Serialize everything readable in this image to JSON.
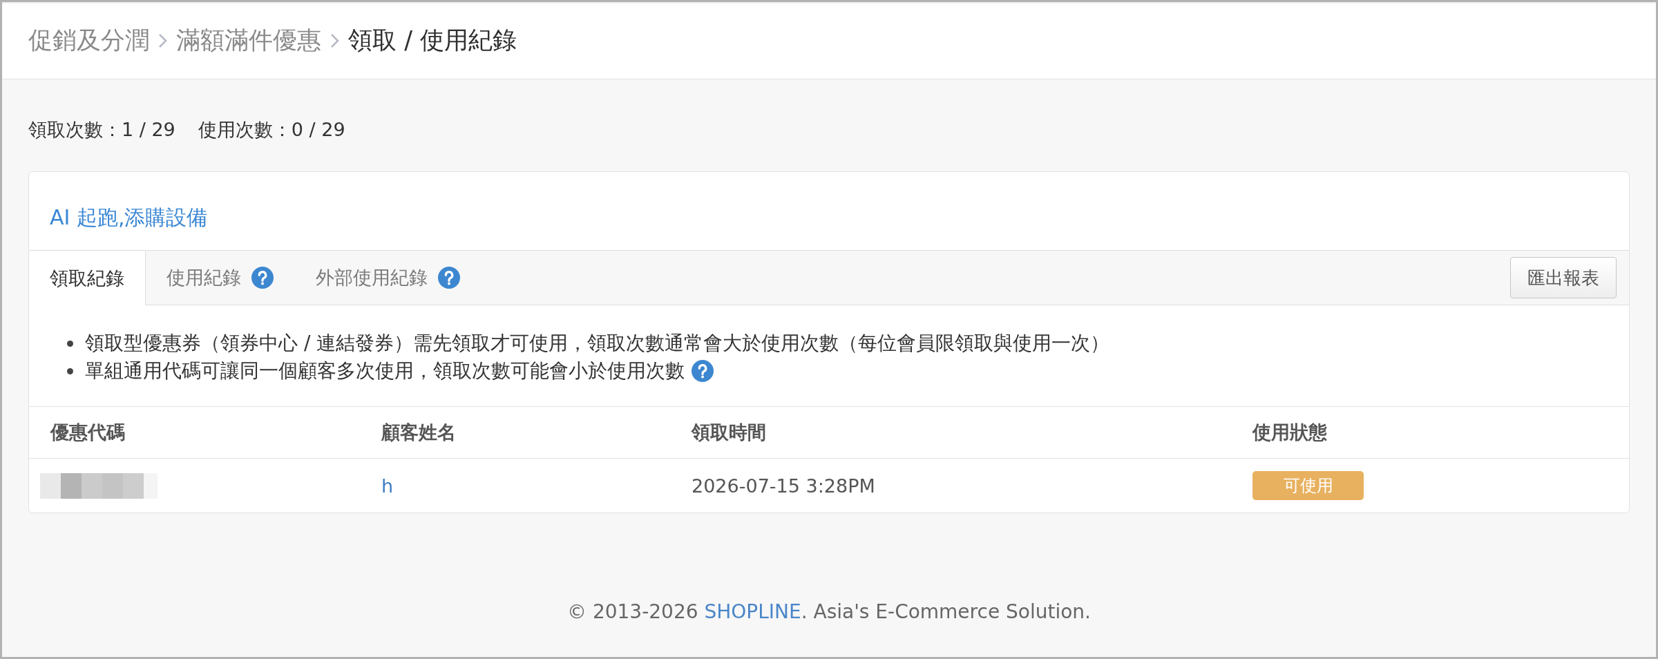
{
  "breadcrumb": [
    {
      "label": "促銷及分潤",
      "current": false
    },
    {
      "label": "滿額滿件優惠",
      "current": false
    },
    {
      "label": "領取 / 使用紀錄",
      "current": true
    }
  ],
  "counts": [
    "領取次數：1 / 29",
    "使用次數：0 / 29"
  ],
  "card": {
    "title": "AI 起跑,添購設備",
    "tabs": [
      {
        "label": "領取紀錄",
        "selected": true,
        "help": false
      },
      {
        "label": "使用紀錄",
        "selected": false,
        "help": true
      },
      {
        "label": "外部使用紀錄",
        "selected": false,
        "help": true
      }
    ],
    "export_button": "匯出報表",
    "notes": [
      {
        "text": "領取型優惠券（領券中心 / 連結發券）需先領取才可使用，領取次數通常會大於使用次數（每位會員限領取與使用一次）",
        "help": false
      },
      {
        "text": "單組通用代碼可讓同一個顧客多次使用，領取次數可能會小於使用次數",
        "help": true
      }
    ],
    "table": {
      "columns": [
        "優惠代碼",
        "顧客姓名",
        "領取時間",
        "使用狀態"
      ],
      "rows": [
        {
          "code_redacted": true,
          "customer": "h",
          "received_at": "2026-07-15 3:28PM",
          "status": {
            "label": "可使用",
            "color": "#e8b15f"
          }
        }
      ]
    }
  },
  "footer": {
    "before": "© 2013-2026 ",
    "link": "SHOPLINE",
    "after": ". Asia's E-Commerce Solution."
  }
}
